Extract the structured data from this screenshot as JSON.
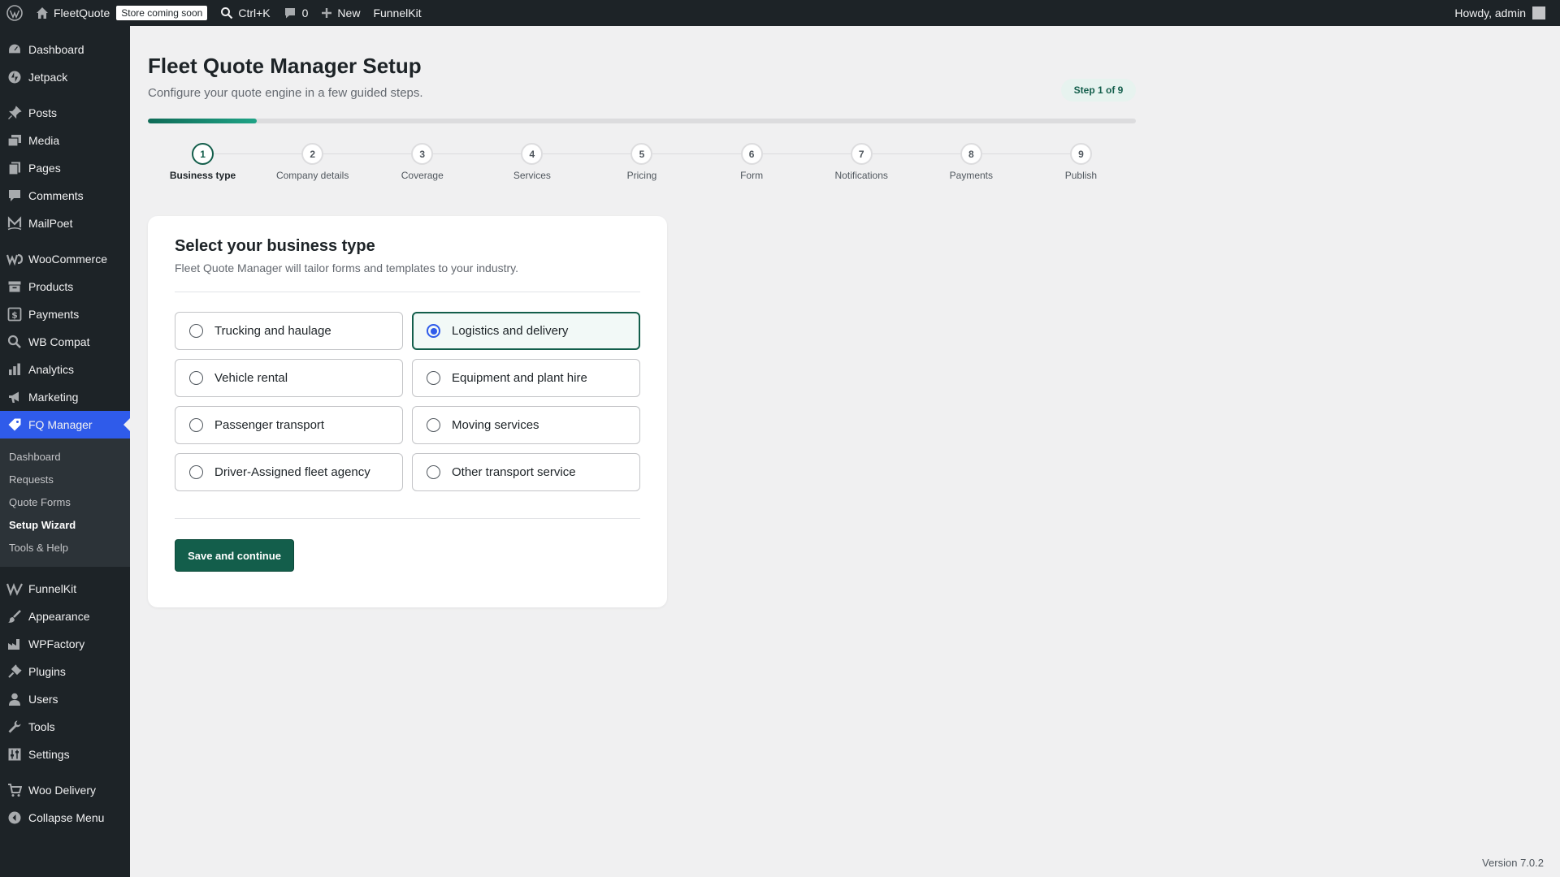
{
  "adminbar": {
    "site_name": "FleetQuote",
    "badge": "Store coming soon",
    "search_shortcut": "Ctrl+K",
    "comments_count": "0",
    "new_label": "New",
    "funnelkit": "FunnelKit",
    "greeting": "Howdy, admin"
  },
  "sidebar": {
    "items": [
      {
        "label": "Dashboard",
        "icon": "dashboard-icon"
      },
      {
        "label": "Jetpack",
        "icon": "jetpack-icon"
      },
      {
        "label": "Posts",
        "icon": "pin-icon"
      },
      {
        "label": "Media",
        "icon": "media-icon"
      },
      {
        "label": "Pages",
        "icon": "pages-icon"
      },
      {
        "label": "Comments",
        "icon": "comment-icon"
      },
      {
        "label": "MailPoet",
        "icon": "mailpoet-icon"
      },
      {
        "label": "WooCommerce",
        "icon": "woo-icon"
      },
      {
        "label": "Products",
        "icon": "archive-icon"
      },
      {
        "label": "Payments",
        "icon": "dollar-icon"
      },
      {
        "label": "WB Compat",
        "icon": "search-icon"
      },
      {
        "label": "Analytics",
        "icon": "bar-chart-icon"
      },
      {
        "label": "Marketing",
        "icon": "megaphone-icon"
      },
      {
        "label": "FQ Manager",
        "icon": "tag-icon"
      },
      {
        "label": "FunnelKit",
        "icon": "funnelkit-icon"
      },
      {
        "label": "Appearance",
        "icon": "brush-icon"
      },
      {
        "label": "WPFactory",
        "icon": "factory-icon"
      },
      {
        "label": "Plugins",
        "icon": "plugin-icon"
      },
      {
        "label": "Users",
        "icon": "user-icon"
      },
      {
        "label": "Tools",
        "icon": "wrench-icon"
      },
      {
        "label": "Settings",
        "icon": "settings-icon"
      },
      {
        "label": "Woo Delivery",
        "icon": "cart-icon"
      },
      {
        "label": "Collapse Menu",
        "icon": "collapse-icon"
      }
    ],
    "submenu": [
      "Dashboard",
      "Requests",
      "Quote Forms",
      "Setup Wizard",
      "Tools & Help"
    ]
  },
  "main": {
    "title": "Fleet Quote Manager Setup",
    "subtitle": "Configure your quote engine in a few guided steps.",
    "step_indicator": "Step 1 of 9",
    "progress": 0.11,
    "steps": [
      {
        "num": "1",
        "label": "Business type"
      },
      {
        "num": "2",
        "label": "Company details"
      },
      {
        "num": "3",
        "label": "Coverage"
      },
      {
        "num": "4",
        "label": "Services"
      },
      {
        "num": "5",
        "label": "Pricing"
      },
      {
        "num": "6",
        "label": "Form"
      },
      {
        "num": "7",
        "label": "Notifications"
      },
      {
        "num": "8",
        "label": "Payments"
      },
      {
        "num": "9",
        "label": "Publish"
      }
    ],
    "card": {
      "title": "Select your business type",
      "subtitle": "Fleet Quote Manager will tailor forms and templates to your industry.",
      "options": [
        "Trucking and haulage",
        "Logistics and delivery",
        "Vehicle rental",
        "Equipment and plant hire",
        "Passenger transport",
        "Moving services",
        "Driver-Assigned fleet agency",
        "Other transport service"
      ],
      "selected": "Logistics and delivery",
      "save_label": "Save and continue"
    },
    "version": "Version 7.0.2"
  },
  "colors": {
    "accent_green": "#135e4b",
    "admin_blue": "#2f5bea",
    "admin_dark": "#1d2327"
  }
}
